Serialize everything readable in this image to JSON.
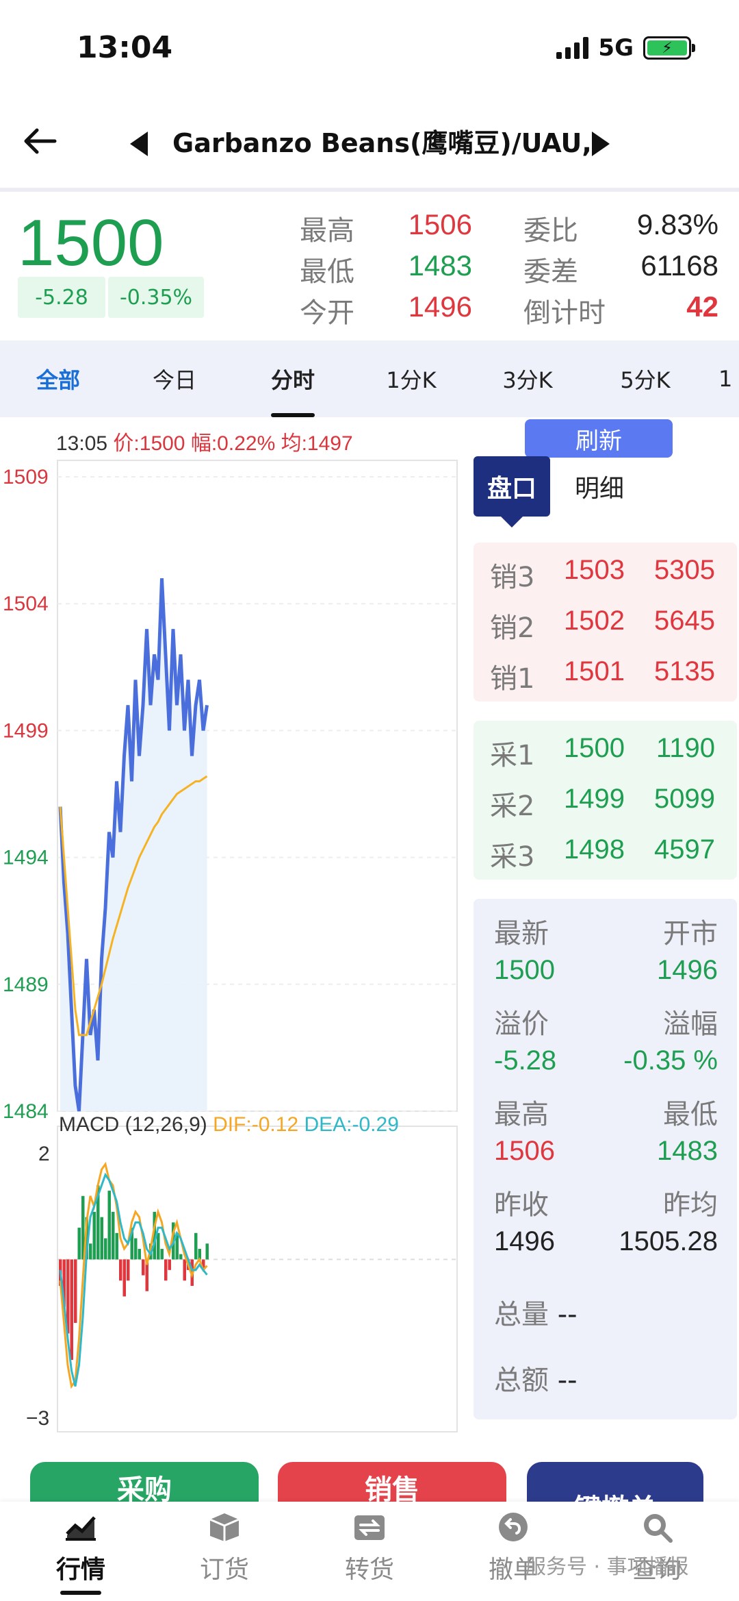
{
  "status_bar": {
    "time": "13:04",
    "network": "5G"
  },
  "header": {
    "title": "Garbanzo Beans(鹰嘴豆)/UAU,"
  },
  "quote": {
    "price": "1500",
    "change": "-5.28",
    "change_pct": "-0.35%",
    "stats": [
      {
        "label": "最高",
        "value": "1506"
      },
      {
        "label": "最低",
        "value": "1483"
      },
      {
        "label": "今开",
        "value": "1496"
      },
      {
        "label": "委比",
        "value": "9.83%"
      },
      {
        "label": "委差",
        "value": "61168"
      },
      {
        "label": "倒计时",
        "value": "42"
      }
    ]
  },
  "tabs": [
    "全部",
    "今日",
    "分时",
    "1分K",
    "3分K",
    "5分K",
    "1"
  ],
  "chart_info": {
    "time": "13:05",
    "price": "价:1500",
    "amp": "幅:0.22%",
    "avg": "均:1497"
  },
  "refresh_label": "刷新",
  "panel_tabs": [
    "盘口",
    "明细"
  ],
  "order_book": {
    "sell": [
      {
        "label": "销3",
        "price": "1503",
        "qty": "5305"
      },
      {
        "label": "销2",
        "price": "1502",
        "qty": "5645"
      },
      {
        "label": "销1",
        "price": "1501",
        "qty": "5135"
      }
    ],
    "buy": [
      {
        "label": "采1",
        "price": "1500",
        "qty": "1190"
      },
      {
        "label": "采2",
        "price": "1499",
        "qty": "5099"
      },
      {
        "label": "采3",
        "price": "1498",
        "qty": "4597"
      }
    ]
  },
  "detail": {
    "latest_label": "最新",
    "latest": "1500",
    "open_label": "开市",
    "open": "1496",
    "premium_label": "溢价",
    "premium": "-5.28",
    "premium_pct_label": "溢幅",
    "premium_pct": "-0.35 %",
    "high_label": "最高",
    "high": "1506",
    "low_label": "最低",
    "low": "1483",
    "prev_close_label": "昨收",
    "prev_close": "1496",
    "prev_avg_label": "昨均",
    "prev_avg": "1505.28",
    "volume_label": "总量",
    "volume": "--",
    "amount_label": "总额",
    "amount": "--"
  },
  "actions": {
    "buy": "采购",
    "sell": "销售",
    "cancel": "键撤单"
  },
  "bottom_nav": [
    "行情",
    "订货",
    "转货",
    "撤单",
    "查询"
  ],
  "watermark": "服务号 · 事项播报",
  "colors": {
    "up": "#e0363e",
    "down": "#1e9e50",
    "accent": "#1f2f80",
    "line": "#4a6fdc",
    "avg": "#f5b323"
  },
  "chart_data": [
    {
      "type": "line",
      "y_ticks": [
        "1509",
        "1504",
        "1499",
        "1494",
        "1489",
        "1484"
      ],
      "ylim": [
        1484,
        1509
      ],
      "series": [
        {
          "values": [
            1496,
            1493,
            1491,
            1488,
            1485,
            1484,
            1487,
            1490,
            1487,
            1488,
            1486,
            1490,
            1492,
            1495,
            1494,
            1497,
            1495,
            1498,
            1500,
            1497,
            1501,
            1498,
            1500,
            1503,
            1500,
            1502,
            1501,
            1505,
            1502,
            1499,
            1503,
            1500,
            1502,
            1499,
            1501,
            1498,
            1500,
            1501,
            1499,
            1500
          ]
        },
        {
          "values": [
            1496,
            1494,
            1492,
            1490,
            1488,
            1487,
            1487,
            1487,
            1487.5,
            1488,
            1488.5,
            1489,
            1489.6,
            1490.2,
            1490.8,
            1491.3,
            1491.8,
            1492.3,
            1492.8,
            1493.2,
            1493.6,
            1494,
            1494.3,
            1494.6,
            1494.9,
            1495.2,
            1495.4,
            1495.7,
            1495.9,
            1496.1,
            1496.3,
            1496.5,
            1496.6,
            1496.7,
            1496.8,
            1496.9,
            1497,
            1497,
            1497.1,
            1497.2
          ]
        }
      ]
    },
    {
      "type": "bar",
      "title": "MACD (12,26,9)",
      "dif_label": "DIF:-0.12",
      "dea_label": "DEA:-0.29",
      "y_ticks": [
        "2",
        "-3"
      ],
      "ylim": [
        -3,
        2
      ],
      "histogram": [
        -0.5,
        -0.9,
        -1.4,
        -1.9,
        -1.2,
        0.6,
        1.2,
        0.8,
        0.3,
        0.9,
        1.4,
        0.8,
        0.4,
        1.3,
        0.9,
        0.5,
        -0.4,
        -0.7,
        -0.4,
        0.6,
        0.4,
        0.2,
        -0.3,
        -0.6,
        0.3,
        0.9,
        0.5,
        0.2,
        -0.4,
        -0.2,
        0.7,
        0.5,
        0.1,
        -0.4,
        -0.2,
        -0.5,
        0.5,
        0.2,
        -0.2,
        0.3
      ],
      "dif": [
        -0.4,
        -1.2,
        -2,
        -2.4,
        -2.3,
        -1.5,
        -0.4,
        0.7,
        1.2,
        1,
        1.4,
        1.7,
        1.8,
        1.5,
        1.4,
        1,
        0.4,
        0.2,
        0.3,
        0.7,
        0.9,
        0.8,
        0.4,
        -0.1,
        0.2,
        0.6,
        0.9,
        0.7,
        0.3,
        0.1,
        0.5,
        0.7,
        0.4,
        0.1,
        -0.1,
        -0.3,
        -0.1,
        0,
        -0.2,
        -0.12
      ],
      "dea": [
        -0.2,
        -0.8,
        -1.5,
        -2.1,
        -2.4,
        -2,
        -1.1,
        0.1,
        0.8,
        1,
        1.2,
        1.4,
        1.6,
        1.5,
        1.3,
        1.1,
        0.7,
        0.4,
        0.3,
        0.5,
        0.7,
        0.7,
        0.5,
        0.2,
        0.1,
        0.3,
        0.6,
        0.6,
        0.4,
        0.2,
        0.3,
        0.5,
        0.4,
        0.2,
        0,
        -0.2,
        -0.2,
        -0.1,
        -0.2,
        -0.29
      ]
    }
  ]
}
